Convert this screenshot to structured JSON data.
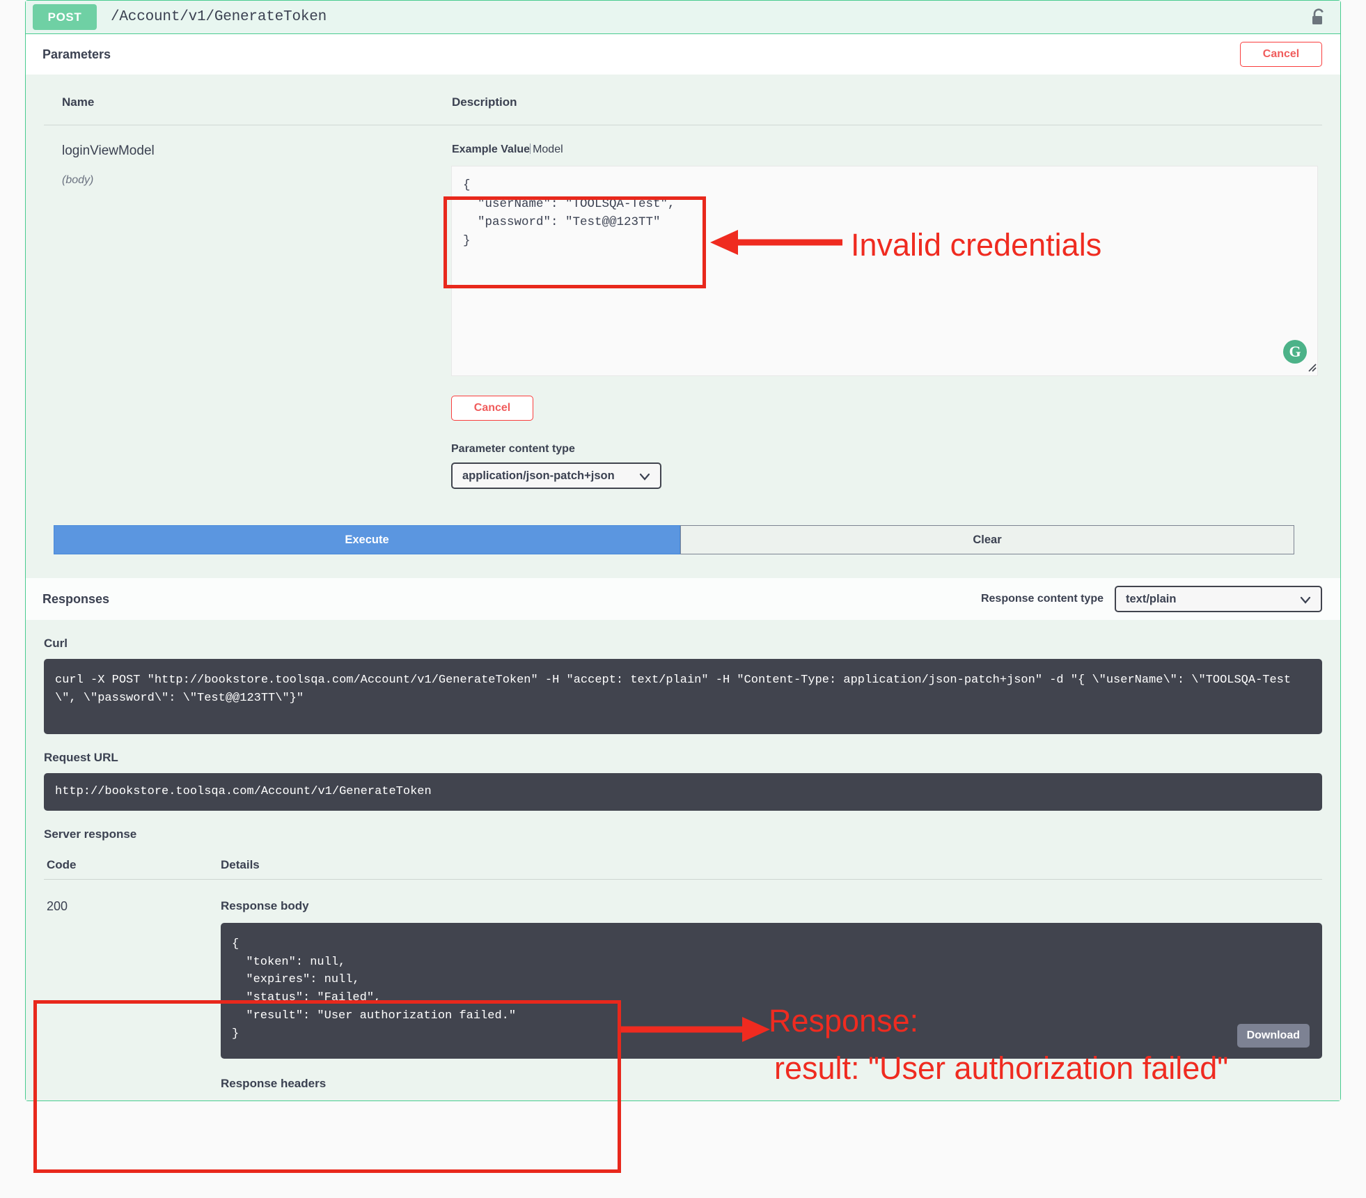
{
  "operation": {
    "method": "POST",
    "path": "/Account/v1/GenerateToken",
    "lock_icon": "padlock-open-icon"
  },
  "parameters": {
    "title": "Parameters",
    "cancel_label": "Cancel",
    "columns": {
      "name": "Name",
      "description": "Description"
    },
    "row": {
      "name": "loginViewModel",
      "type": "(body)"
    },
    "example_tabs": {
      "active": "Example Value",
      "inactive": "Model"
    },
    "request_body": "{\n  \"userName\": \"TOOLSQA-Test\",\n  \"password\": \"Test@@123TT\"\n}",
    "grammarly_icon": "G",
    "cancel_body_label": "Cancel",
    "content_type_label": "Parameter content type",
    "content_type_value": "application/json-patch+json",
    "execute_label": "Execute",
    "clear_label": "Clear"
  },
  "responses": {
    "title": "Responses",
    "content_type_label": "Response content type",
    "content_type_value": "text/plain",
    "curl_label": "Curl",
    "curl_value": "curl -X POST \"http://bookstore.toolsqa.com/Account/v1/GenerateToken\" -H \"accept: text/plain\" -H \"Content-Type: application/json-patch+json\" -d \"{ \\\"userName\\\": \\\"TOOLSQA-Test\\\", \\\"password\\\": \\\"Test@@123TT\\\"}\"",
    "request_url_label": "Request URL",
    "request_url_value": "http://bookstore.toolsqa.com/Account/v1/GenerateToken",
    "server_response_label": "Server response",
    "columns": {
      "code": "Code",
      "details": "Details"
    },
    "code": "200",
    "response_body_label": "Response body",
    "response_body_value": "{\n  \"token\": null,\n  \"expires\": null,\n  \"status\": \"Failed\",\n  \"result\": \"User authorization failed.\"\n}",
    "download_label": "Download",
    "response_headers_label": "Response headers"
  },
  "annotations": {
    "color": "#ef2b20",
    "invalid_credentials": "Invalid credentials",
    "response_label": "Response:",
    "response_result": "result: \"User authorization failed\""
  }
}
